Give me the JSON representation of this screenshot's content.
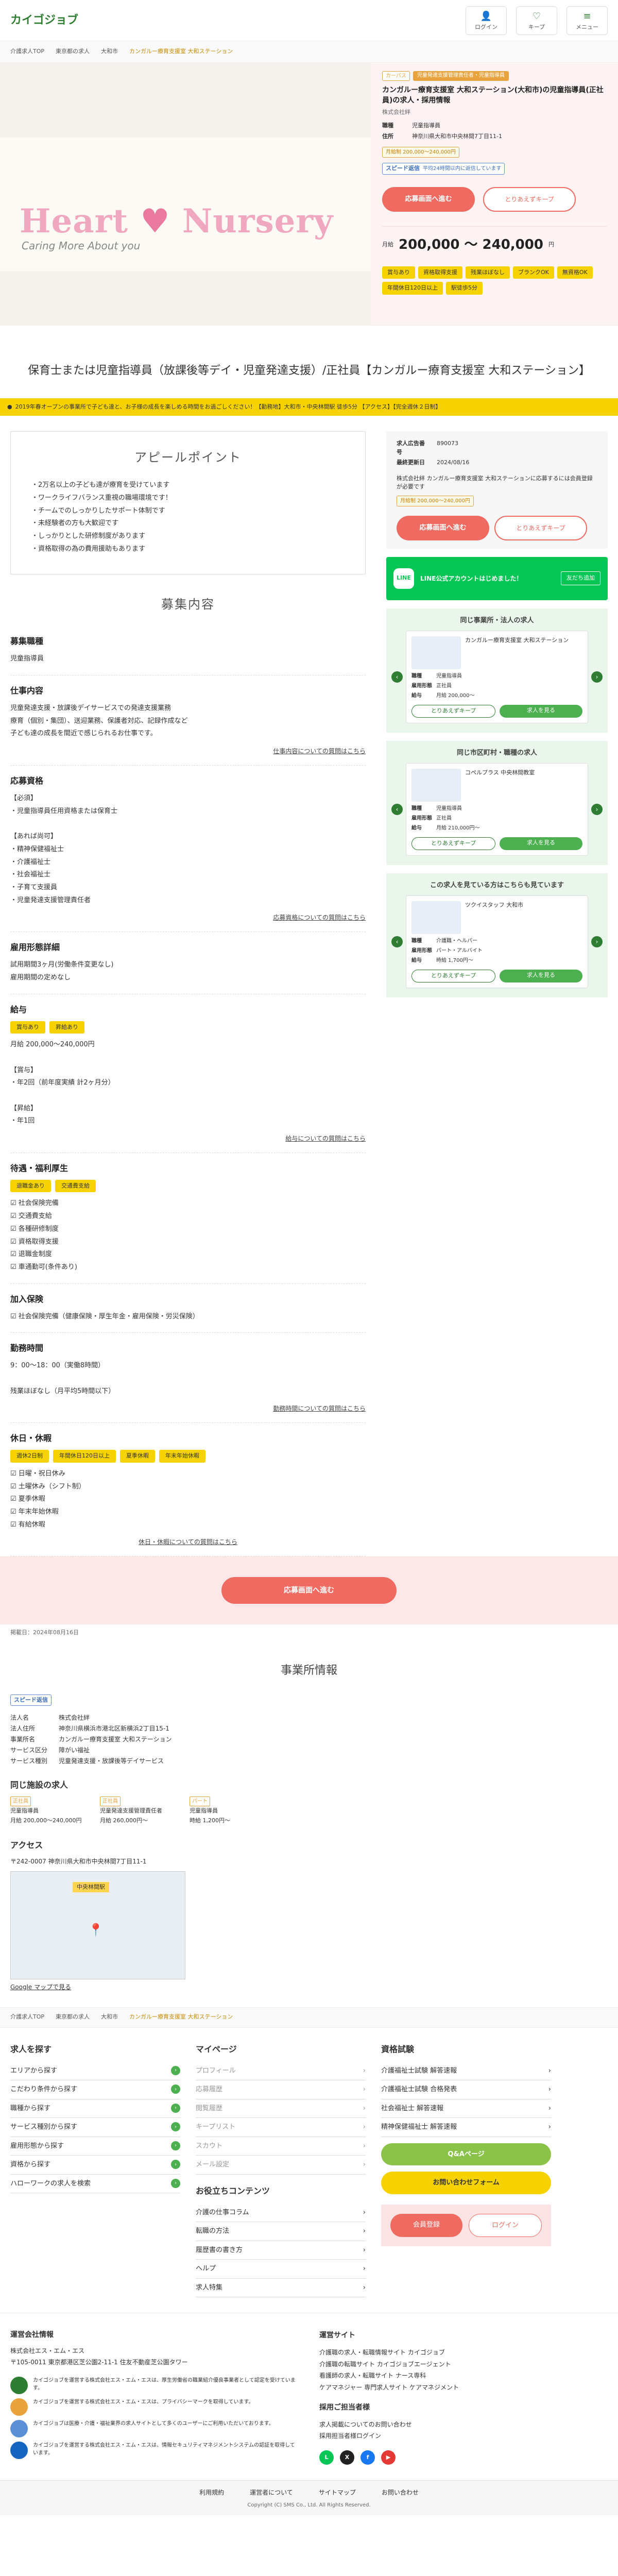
{
  "header": {
    "logo": "カイゴジョブ",
    "icons": [
      {
        "label": "ログイン",
        "icon": "user-icon"
      },
      {
        "label": "キープ",
        "icon": "heart-icon"
      },
      {
        "label": "メニュー",
        "icon": "menu-icon"
      }
    ]
  },
  "breadcrumb": [
    "介護求人TOP",
    "東京都の求人",
    "大和市",
    "カンガルー療育支援室 大和ステーション"
  ],
  "hero": {
    "logo_word1": "Heart",
    "logo_word2": "Nursery",
    "tagline": "Caring More About you",
    "tag1": "カーパス",
    "tag2": "児童発達支援管理責任者・児童指導員",
    "title": "カンガルー療育支援室 大和ステーション(大和市)の児童指導員(正社員)の求人・採用情報",
    "company": "株式会社絆",
    "kv": [
      {
        "k": "職種",
        "v": "児童指導員"
      },
      {
        "k": "住所",
        "v": "神奈川県大和市中央林間7丁目11-1"
      }
    ],
    "salary_pill": "月給制 200,000〜240,000円",
    "speed_title": "スピード返信",
    "speed_sub": "平均24時間以内に返信しています",
    "btn_apply": "応募画面へ進む",
    "btn_keep": "とりあえずキープ",
    "salary_label": "月給",
    "salary_value": "200,000 〜 240,000",
    "salary_unit": "円",
    "tags": [
      "賞与あり",
      "資格取得支援",
      "残業ほぼなし",
      "ブランクOK",
      "無資格OK",
      "年間休日120日以上",
      "駅徒歩5分"
    ]
  },
  "main_title": "保育士または児童指導員（放課後等デイ・児童発達支援）/正社員【カンガルー療育支援室 大和ステーション】",
  "info_strip": "2019年春オープンの事業所で子ども達と、お子様の成長を楽しめる時間をお過ごしください！【勤務地】大和市・中央林間駅 徒歩5分 【アクセス】【完全週休２日制】",
  "appeal": {
    "heading": "アピールポイント",
    "items": [
      "・2万名以上の子ども達が療育を受けています",
      "・ワークライフバランス重視の職場環境です！",
      "・チームでのしっかりしたサポート体制です",
      "・未経験者の方も大歓迎です",
      "・しっかりとした研修制度があります",
      "・資格取得の為の費用援助もあります"
    ]
  },
  "recruit": {
    "heading": "募集内容",
    "job_h": "募集職種",
    "job": "児童指導員",
    "work_h": "仕事内容",
    "work": "児童発達支援・放課後デイサービスでの発達支援業務\n療育（個別・集団）、送迎業務、保護者対応、記録作成など\n子ども達の成長を間近で感じられるお仕事です。",
    "more1": "仕事内容についての質問はこちら",
    "req_h": "応募資格",
    "req": "【必須】\n・児童指導員任用資格または保育士\n\n【あれば尚可】\n・精神保健福祉士\n・介護福祉士\n・社会福祉士\n・子育て支援員\n・児童発達支援管理責任者",
    "more2": "応募資格についての質問はこちら",
    "emp_h": "雇用形態詳細",
    "emp": "試用期間3ヶ月(労働条件変更なし)\n雇用期間の定めなし",
    "sal_h": "給与",
    "sal_chips": [
      "賞与あり",
      "昇給あり"
    ],
    "sal": "月給 200,000〜240,000円\n\n【賞与】\n・年2回（前年度実績 計2ヶ月分）\n\n【昇給】\n・年1回",
    "more3": "給与についての質問はこちら",
    "ben_h": "待遇・福利厚生",
    "ben_chips": [
      "退職金あり",
      "交通費支給"
    ],
    "ben": [
      "☑ 社会保険完備",
      "☑ 交通費支給",
      "☑ 各種研修制度",
      "☑ 資格取得支援",
      "☑ 退職金制度",
      "☑ 車通勤可(条件あり)"
    ],
    "ins_h": "加入保険",
    "ins": "☑ 社会保険完備（健康保険・厚生年金・雇用保険・労災保険）",
    "hour_h": "勤務時間",
    "hour": "9：00〜18：00（実働8時間）\n\n残業ほぼなし（月平均5時間以下）",
    "more4": "勤務時間についての質問はこちら",
    "hol_h": "休日・休暇",
    "hol_chips": [
      "週休2日制",
      "年間休日120日以上",
      "夏季休暇",
      "年末年始休暇"
    ],
    "hol": [
      "☑ 日曜・祝日休み",
      "☑ 土曜休み（シフト制）",
      "☑ 夏季休暇",
      "☑ 年末年始休暇",
      "☑ 有給休暇"
    ],
    "more5": "休日・休暇についての質問はこちら",
    "apply": "応募画面へ進む",
    "updated": "掲載日：2024年08月16日"
  },
  "side": {
    "kv": [
      {
        "k": "求人広告番号",
        "v": "890073"
      },
      {
        "k": "最終更新日",
        "v": "2024/08/16"
      }
    ],
    "desc": "株式会社絆 カンガルー療育支援室 大和ステーションに応募するには会員登録が必要です",
    "salary_pill": "月給制 200,000〜240,000円",
    "btn_apply": "応募画面へ進む",
    "btn_keep": "とりあえずキープ",
    "line_logo": "LINE",
    "line_t1": "LINE公式アカウントはじめました！",
    "line_r": "友だち追加",
    "rel1": "同じ事業所・法人の求人",
    "rel2": "同じ市区町村・職種の求人",
    "rel3": "この求人を見ている方はこちらも見ています",
    "cards": [
      {
        "title": "カンガルー療育支援室 大和ステーション",
        "kv": [
          {
            "k": "職種",
            "v": "児童指導員"
          },
          {
            "k": "雇用形態",
            "v": "正社員"
          },
          {
            "k": "給与",
            "v": "月給 200,000〜"
          }
        ]
      },
      {
        "title": "コペルプラス 中央林間教室",
        "kv": [
          {
            "k": "職種",
            "v": "児童指導員"
          },
          {
            "k": "雇用形態",
            "v": "正社員"
          },
          {
            "k": "給与",
            "v": "月給 210,000円〜"
          }
        ]
      },
      {
        "title": "ツクイスタッフ 大和市",
        "kv": [
          {
            "k": "職種",
            "v": "介護職・ヘルパー"
          },
          {
            "k": "雇用形態",
            "v": "パート・アルバイト"
          },
          {
            "k": "給与",
            "v": "時給 1,700円〜"
          }
        ]
      }
    ],
    "card_keep": "とりあえずキープ",
    "card_more": "求人を見る"
  },
  "office": {
    "heading": "事業所情報",
    "speed": "スピード返信",
    "kv": [
      {
        "k": "法人名",
        "v": "株式会社絆"
      },
      {
        "k": "法人住所",
        "v": "神奈川県横浜市港北区新横浜2丁目15-1"
      },
      {
        "k": "事業所名",
        "v": "カンガルー療育支援室 大和ステーション"
      },
      {
        "k": "サービス区分",
        "v": "障がい福祉"
      },
      {
        "k": "サービス種別",
        "v": "児童発達支援・放課後等デイサービス"
      }
    ],
    "same_h": "同じ施設の求人",
    "same": [
      {
        "lbl": "正社員",
        "t": "児童指導員",
        "d": "月給 200,000〜240,000円"
      },
      {
        "lbl": "正社員",
        "t": "児童発達支援管理責任者",
        "d": "月給 260,000円〜"
      },
      {
        "lbl": "パート",
        "t": "児童指導員",
        "d": "時給 1,200円〜"
      }
    ],
    "access_h": "アクセス",
    "access": "〒242-0007 神奈川県大和市中央林間7丁目11-1",
    "map_label": "中央林間駅",
    "map_link": "Google マップで見る"
  },
  "crumbs2": [
    "介護求人TOP",
    "東京都の求人",
    "大和市",
    "カンガルー療育支援室 大和ステーション"
  ],
  "footer": {
    "search_h": "求人を探す",
    "search": [
      "エリアから探す",
      "こだわり条件から探す",
      "職種から探す",
      "サービス種別から探す",
      "雇用形態から探す",
      "資格から探す",
      "ハローワークの求人を検索"
    ],
    "my_h": "マイページ",
    "my": [
      "プロフィール",
      "応募履歴",
      "閲覧履歴",
      "キープリスト",
      "スカウト",
      "メール設定",
      "会員登録・ログイン"
    ],
    "exam_h": "資格試験",
    "exam": [
      "介護福祉士試験 解答速報",
      "介護福祉士試験 合格発表",
      "社会福祉士 解答速報",
      "精神保健福祉士 解答速報"
    ],
    "qa": "Q&Aページ",
    "contact": "お問い合わせフォーム",
    "reg": "会員登録",
    "login": "ログイン",
    "content_h": "お役立ちコンテンツ",
    "content": [
      "介護の仕事コラム",
      "転職の方法",
      "履歴書の書き方",
      "ヘルプ",
      "求人特集"
    ]
  },
  "company": {
    "h": "運営会社情報",
    "name": "株式会社エス・エム・エス",
    "addr": "〒105-0011 東京都港区芝公園2-11-1 住友不動産芝公園タワー",
    "certs": [
      "カイゴジョブを運営する株式会社エス・エム・エスは、厚生労働省の職業紹介優良事業者として認定を受けています。",
      "カイゴジョブを運営する株式会社エス・エム・エスは、プライバシーマークを取得しています。",
      "カイゴジョブは医療・介護・福祉業界の求人サイトとして多くのユーザーにご利用いただいております。",
      "カイゴジョブを運営する株式会社エス・エム・エスは、情報セキュリティマネジメントシステムの認証を取得しています。"
    ],
    "op_h": "運営サイト",
    "ops": [
      "介護職の求人・転職情報サイト カイゴジョブ",
      "介護職の転職サイト カイゴジョブエージェント",
      "看護師の求人・転職サイト ナース専科",
      "ケアマネジャー 専門求人サイト ケアマネジメント"
    ],
    "hire_h": "採用ご担当者様",
    "hire": [
      "求人掲載についてのお問い合わせ",
      "採用担当者様ログイン"
    ],
    "sns": [
      {
        "t": "L",
        "c": "#06c755"
      },
      {
        "t": "X",
        "c": "#222222"
      },
      {
        "t": "f",
        "c": "#1877f2"
      },
      {
        "t": "▶",
        "c": "#e53935"
      }
    ]
  },
  "bottom": {
    "links": [
      "利用規約",
      "運営者について",
      "サイトマップ",
      "お問い合わせ"
    ],
    "copy": "Copyright (C) SMS Co., Ltd. All Rights Reserved."
  }
}
